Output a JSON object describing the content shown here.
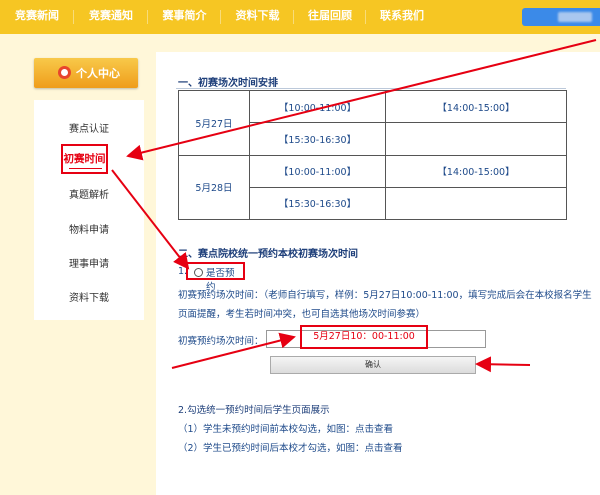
{
  "nav": {
    "items": [
      {
        "label": "竞赛新闻",
        "w": 74
      },
      {
        "label": "竞赛通知",
        "w": 74
      },
      {
        "label": "赛事简介",
        "w": 73
      },
      {
        "label": "资料下载",
        "w": 73
      },
      {
        "label": "往届回顾",
        "w": 72
      },
      {
        "label": "联系我们",
        "w": 72
      }
    ]
  },
  "sidebar": {
    "header": "个人中心",
    "items": [
      "赛点认证",
      "初赛时间",
      "真题解析",
      "物料申请",
      "理事申请",
      "资料下载"
    ],
    "active": "初赛时间"
  },
  "section1": {
    "title": "一、初赛场次时间安排",
    "table": {
      "rows": [
        {
          "date": "5月27日",
          "slots": [
            [
              "【10:00-11:00】",
              "【14:00-15:00】"
            ],
            [
              "【15:30-16:30】",
              ""
            ]
          ]
        },
        {
          "date": "5月28日",
          "slots": [
            [
              "【10:00-11:00】",
              "【14:00-15:00】"
            ],
            [
              "【15:30-16:30】",
              ""
            ]
          ]
        }
      ]
    }
  },
  "section2": {
    "title": "二、赛点院校统一预约本校初赛场次时间",
    "item1_num": "1.",
    "radio_label": "是否预约",
    "note_line1": "初赛预约场次时间：（老师自行填写，样例：5月27日10:00-11:00，填写完成后会在本校报名学生",
    "note_line2": "页面提醒，考生若时间冲突，也可自选其他场次时间参赛）",
    "input_label": "初赛预约场次时间：",
    "input_value": "5月27日10：00-11:00",
    "confirm_label": "确认",
    "item2_title": "2.勾选统一预约时间后学生页面展示",
    "item2_line1": "（1）学生未预约时间前本校勾选，如图：点击查看",
    "item2_line2": "（2）学生已预约时间后本校才勾选，如图：点击查看"
  },
  "colors": {
    "topbar": "#f6c623",
    "annotation": "#e60012",
    "link": "#1e4a8a"
  }
}
